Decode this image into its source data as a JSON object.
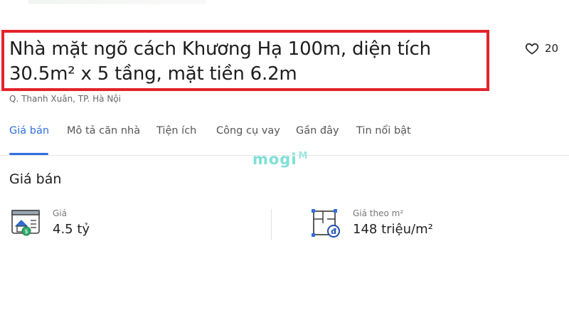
{
  "listing": {
    "title": "Nhà mặt ngõ cách Khương Hạ 100m, diện tích 30.5m² x 5 tầng, mặt tiền 6.2m",
    "location": "Q. Thanh Xuân, TP. Hà Nội",
    "likes": "20"
  },
  "tabs": [
    {
      "label": "Giá bán",
      "active": true
    },
    {
      "label": "Mô tả căn nhà"
    },
    {
      "label": "Tiện ích"
    },
    {
      "label": "Công cụ vay"
    },
    {
      "label": "Gần đây"
    },
    {
      "label": "Tin nổi bật"
    }
  ],
  "watermark": {
    "text": "mogi",
    "mark": "M"
  },
  "price_section": {
    "title": "Giá bán",
    "price": {
      "label": "Giá",
      "value": "4.5 tỷ",
      "icon": "house-money-icon"
    },
    "price_per_m2": {
      "label": "Giá theo m²",
      "value": "148 triệu/m²",
      "icon": "floorplan-price-icon"
    }
  },
  "colors": {
    "accent": "#2f6fe0",
    "highlight_border": "#e3232b",
    "watermark": "#7fdfd7"
  }
}
